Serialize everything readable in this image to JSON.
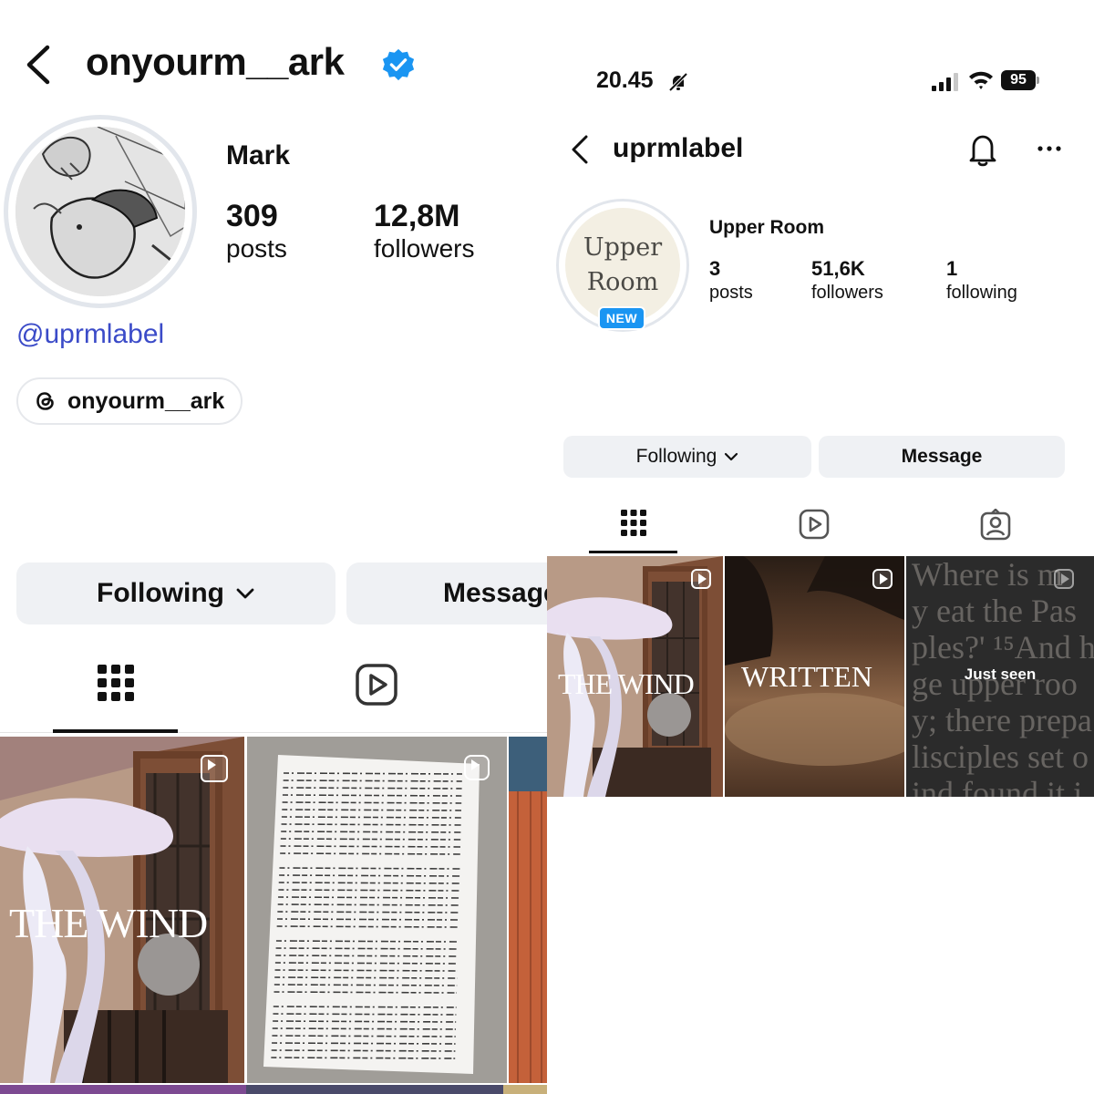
{
  "left": {
    "header": {
      "username": "onyourm__ark"
    },
    "profile": {
      "name": "Mark",
      "posts_count": "309",
      "posts_label": "posts",
      "followers_count": "12,8M",
      "followers_label": "followers",
      "link": "@uprmlabel",
      "threads_handle": "onyourm__ark"
    },
    "actions": {
      "following_label": "Following",
      "message_label": "Message"
    },
    "grid": [
      {
        "label": "THE WIND",
        "icon": "reel-icon"
      },
      {
        "label": "",
        "icon": "carousel-icon"
      }
    ]
  },
  "right": {
    "status_bar": {
      "time": "20.45",
      "battery": "95"
    },
    "header": {
      "username": "uprmlabel"
    },
    "profile": {
      "avatar_line1": "Upper",
      "avatar_line2": "Room",
      "new_badge": "NEW",
      "name": "Upper Room",
      "posts_count": "3",
      "posts_label": "posts",
      "followers_count": "51,6K",
      "followers_label": "followers",
      "following_count": "1",
      "following_label": "following"
    },
    "actions": {
      "following_label": "Following",
      "message_label": "Message"
    },
    "grid": [
      {
        "label": "THE WIND",
        "icon": "reel-icon"
      },
      {
        "label": "WRITTEN",
        "icon": "reel-icon"
      },
      {
        "label": "Just seen",
        "icon": "reel-icon",
        "scripture_lines": [
          "Where is m",
          "y eat the Pas",
          "ples?' ¹⁵And h",
          "ge upper roo",
          "y; there prepa",
          "lisciples set o",
          "ind found it j"
        ]
      }
    ]
  },
  "colors": {
    "link_blue": "#3b4bc8",
    "verified_blue": "#1a95f2",
    "button_bg": "#eff1f4",
    "new_badge": "#1a95f2"
  }
}
